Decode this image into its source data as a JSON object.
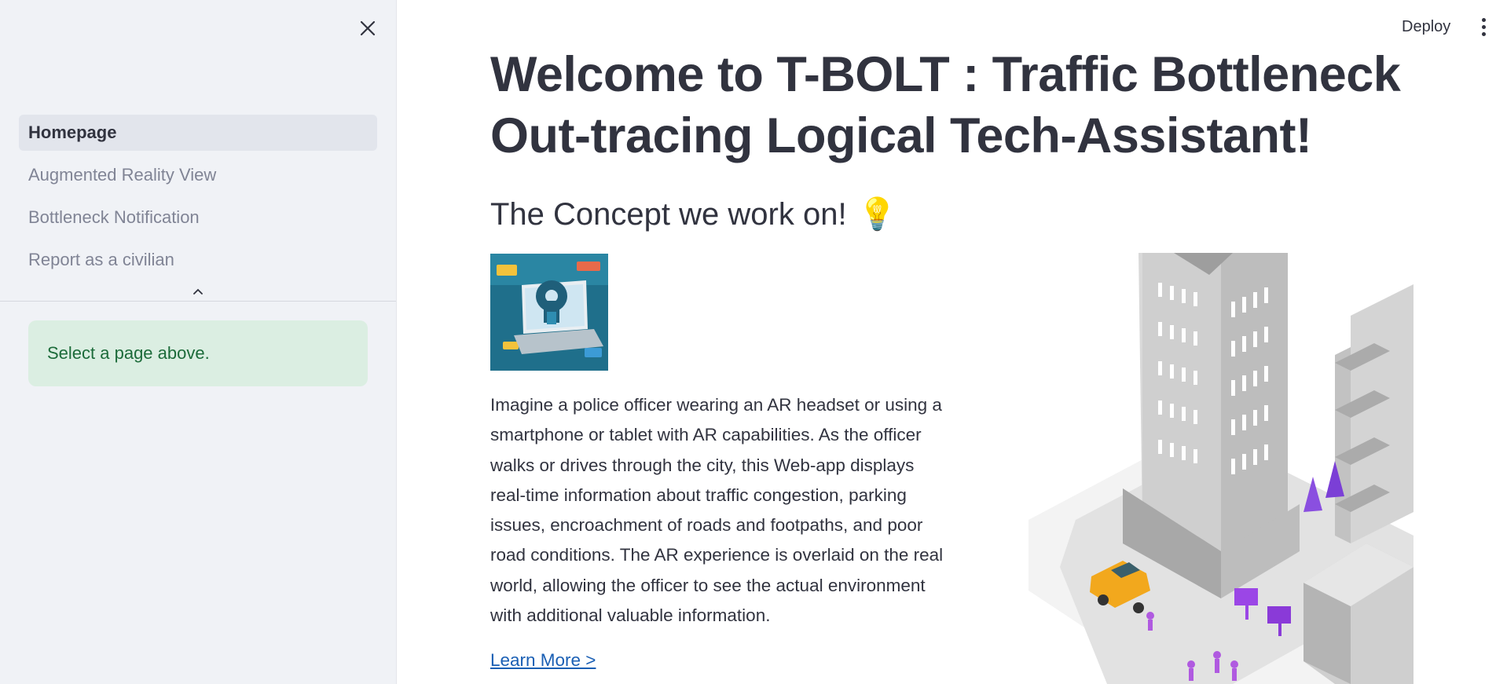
{
  "sidebar": {
    "nav_items": [
      {
        "label": "Homepage",
        "active": true
      },
      {
        "label": "Augmented Reality View",
        "active": false
      },
      {
        "label": "Bottleneck Notification",
        "active": false
      },
      {
        "label": "Report as a civilian",
        "active": false
      }
    ],
    "info_message": "Select a page above."
  },
  "header": {
    "deploy_label": "Deploy"
  },
  "main": {
    "title": "Welcome to T-BOLT : Traffic Bottleneck Out-tracing Logical Tech-Assistant!",
    "subheading": "The Concept we work on!",
    "subheading_emoji": "💡",
    "description": "Imagine a police officer wearing an AR headset or using a smartphone or tablet with AR capabilities. As the officer walks or drives through the city, this Web-app displays real-time information about traffic congestion, parking issues, encroachment of roads and footpaths, and poor road conditions. The AR experience is overlaid on the real world, allowing the officer to see the actual environment with additional valuable information.",
    "link_label": "Learn More >"
  },
  "colors": {
    "sidebar_bg": "#f0f2f6",
    "active_item_bg": "#e2e5ec",
    "info_bg": "#dbeee2",
    "info_text": "#1c6b3a",
    "link": "#1a5fb4"
  }
}
